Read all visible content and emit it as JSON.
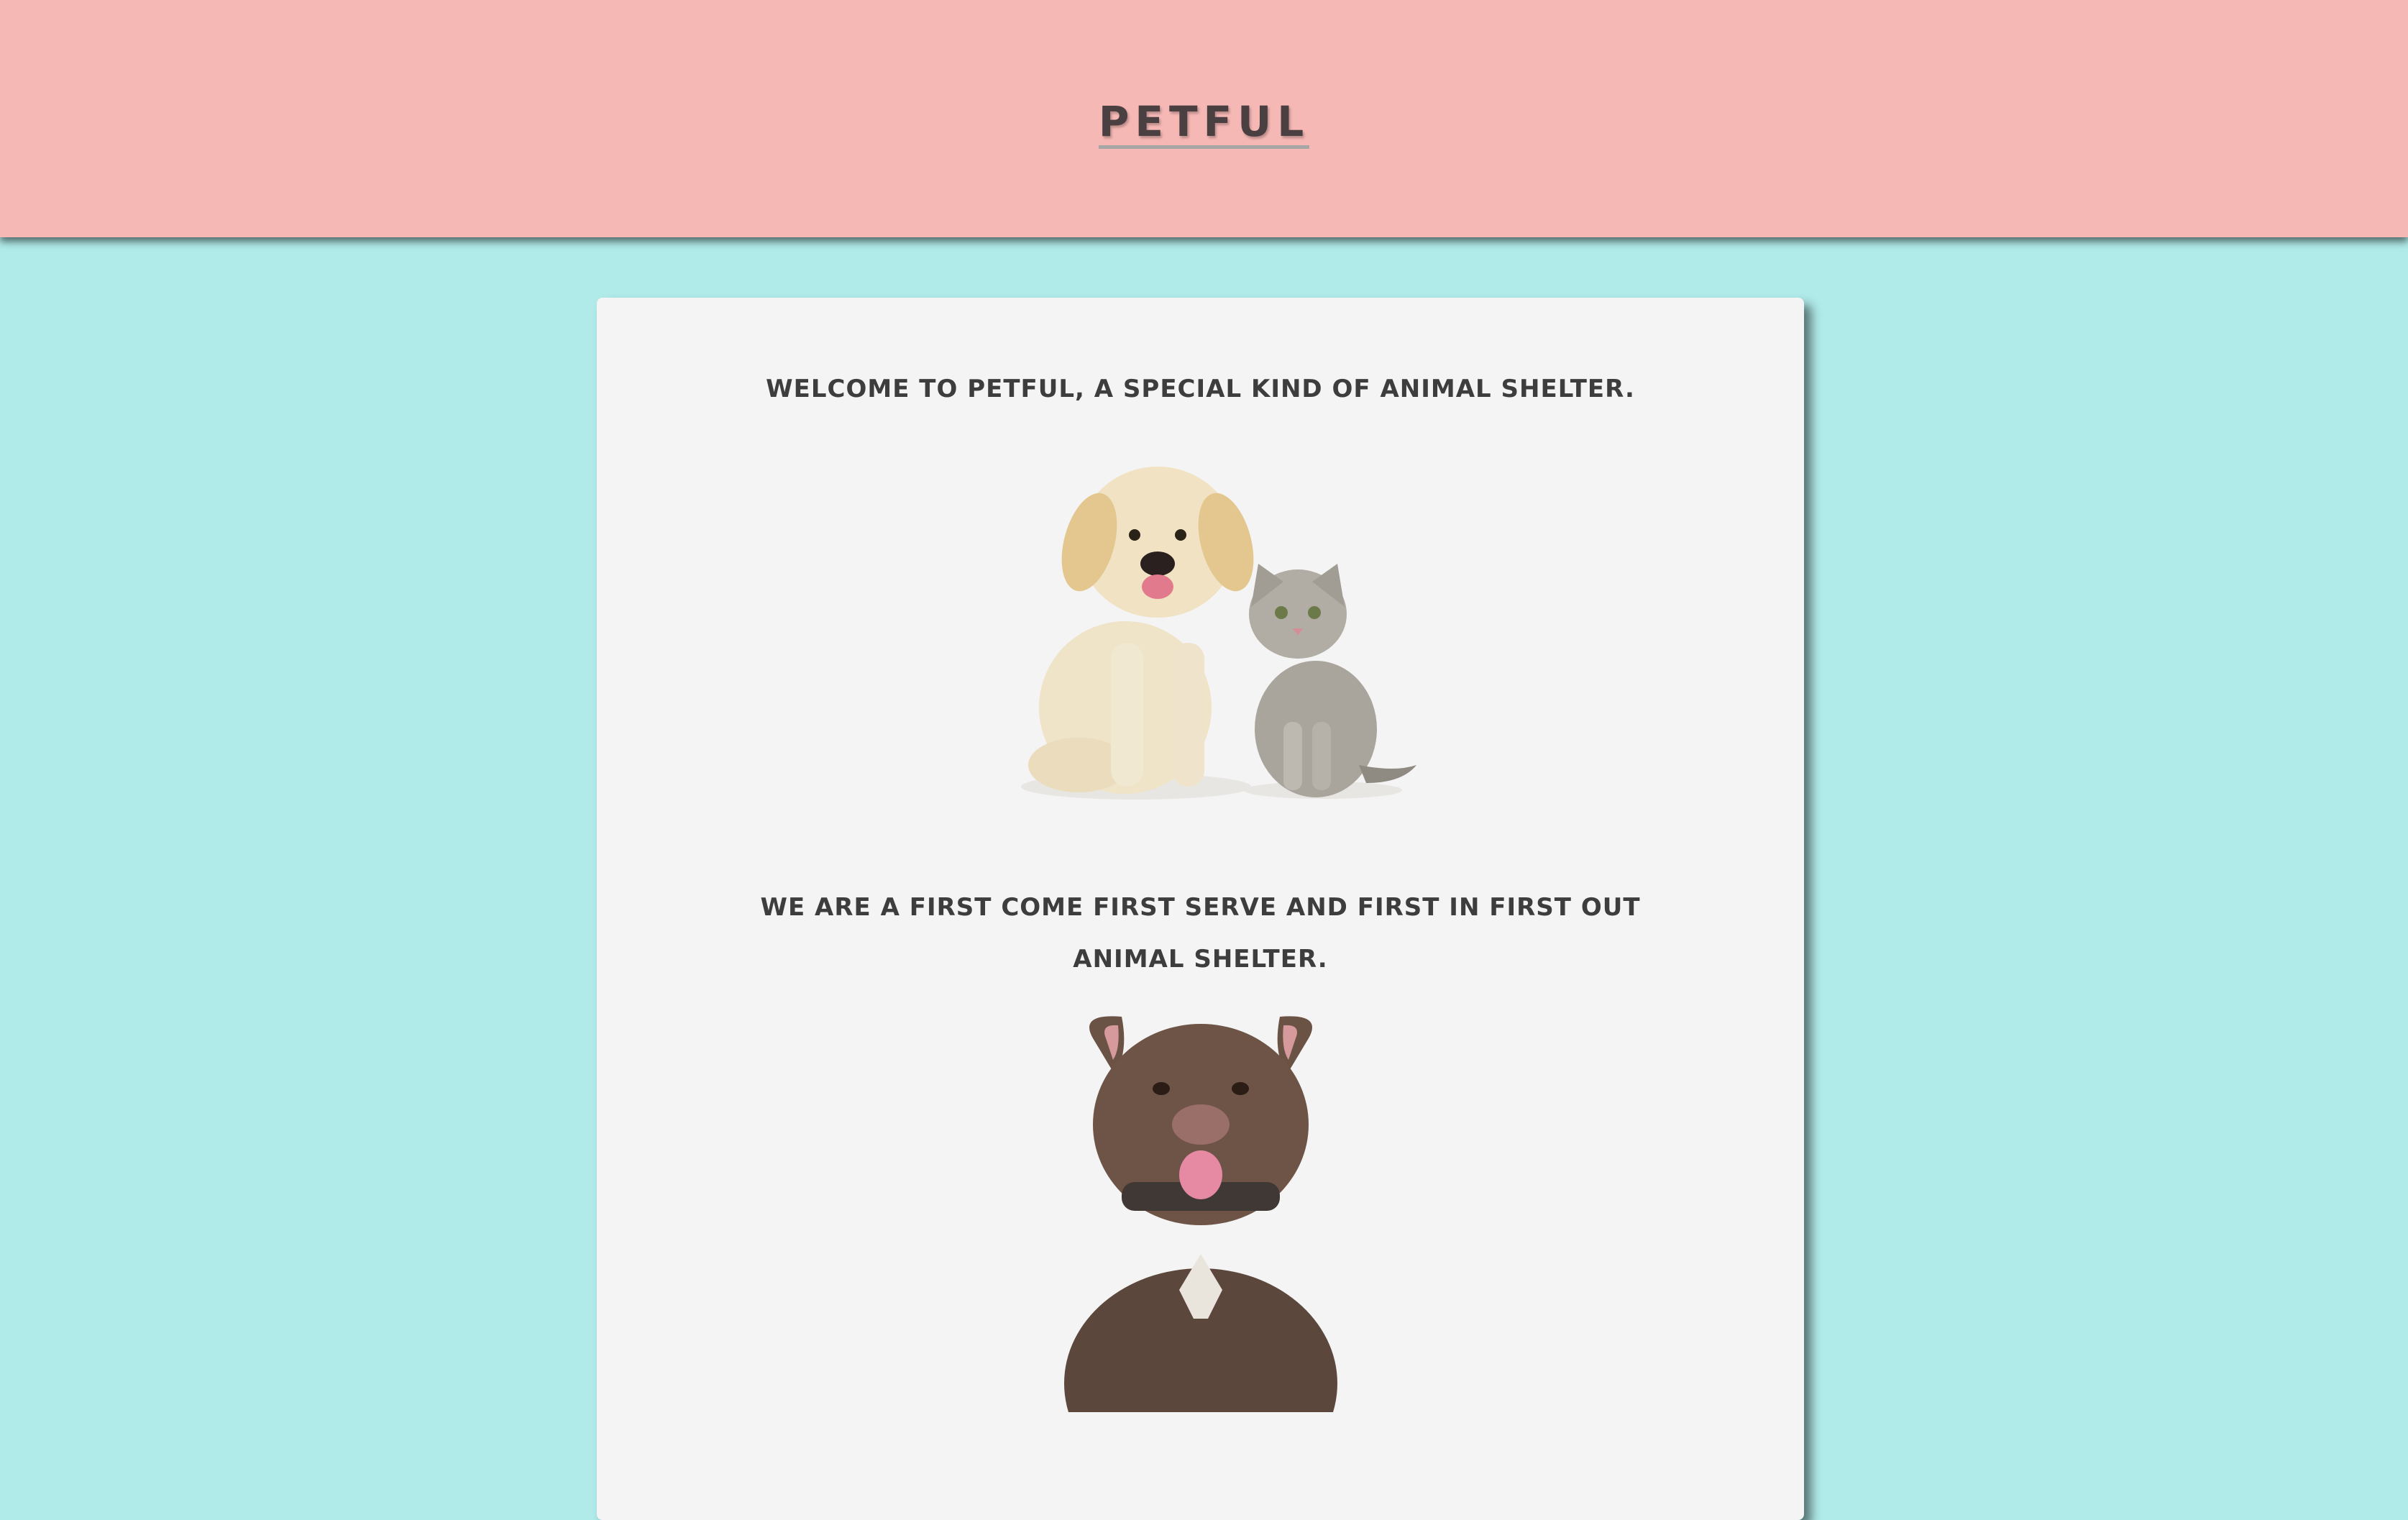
{
  "header": {
    "logo_text": "PETFUL",
    "background_color": "#f6b8b5"
  },
  "page": {
    "background_color": "#b0eae9"
  },
  "main": {
    "welcome_text": "WELCOME TO PETFUL, A SPECIAL KIND OF ANIMAL SHELTER.",
    "policy_text": "WE ARE A FIRST COME FIRST SERVE AND FIRST IN FIRST OUT ANIMAL SHELTER.",
    "images": [
      {
        "name": "puppy-and-kitten-image"
      },
      {
        "name": "brown-pitbull-image"
      }
    ]
  }
}
